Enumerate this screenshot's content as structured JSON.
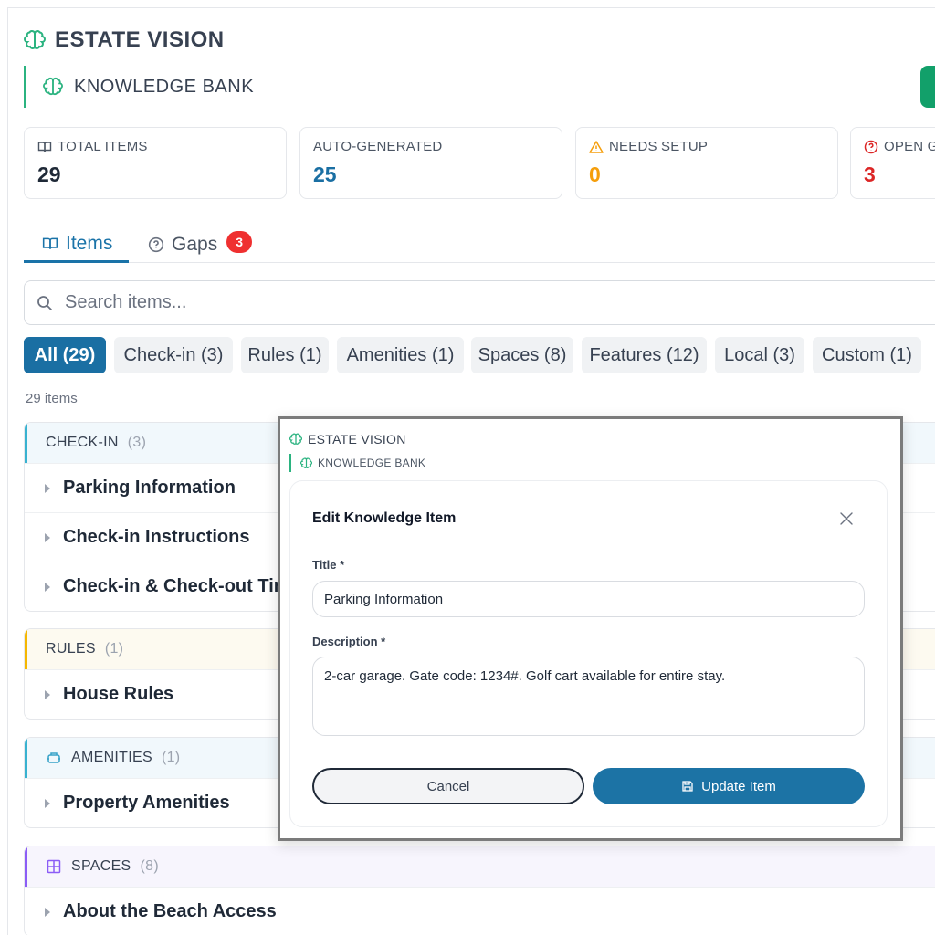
{
  "app": {
    "title": "ESTATE VISION"
  },
  "page": {
    "title": "KNOWLEDGE BANK"
  },
  "stats": [
    {
      "label": "TOTAL ITEMS",
      "value": "29",
      "icon": "book-icon",
      "color": "#1f2937"
    },
    {
      "label": "AUTO-GENERATED",
      "value": "25",
      "icon": "",
      "color": "#1a6fa3"
    },
    {
      "label": "NEEDS SETUP",
      "value": "0",
      "icon": "warning-icon",
      "color": "#f59e0b"
    },
    {
      "label": "OPEN G",
      "value": "3",
      "icon": "question-circle-icon",
      "color": "#dc2626"
    }
  ],
  "tabs": [
    {
      "label": "Items",
      "icon": "book-icon",
      "active": true
    },
    {
      "label": "Gaps",
      "icon": "question-circle-icon",
      "badge": "3"
    }
  ],
  "search": {
    "placeholder": "Search items..."
  },
  "filters": [
    {
      "label": "All (29)",
      "active": true
    },
    {
      "label": "Check-in (3)"
    },
    {
      "label": "Rules (1)"
    },
    {
      "label": "Amenities (1)"
    },
    {
      "label": "Spaces (8)"
    },
    {
      "label": "Features (12)"
    },
    {
      "label": "Local (3)"
    },
    {
      "label": "Custom (1)"
    }
  ],
  "count_text": "29 items",
  "groups": [
    {
      "name": "CHECK-IN",
      "count": "(3)",
      "accent": "#38b2d0",
      "icon": "",
      "items": [
        "Parking Information",
        "Check-in Instructions",
        "Check-in & Check-out Time"
      ]
    },
    {
      "name": "RULES",
      "count": "(1)",
      "accent": "#f5b700",
      "icon": "",
      "items": [
        "House Rules"
      ]
    },
    {
      "name": "AMENITIES",
      "count": "(1)",
      "accent": "#38b2d0",
      "icon": "amenities-icon",
      "items": [
        "Property Amenities"
      ]
    },
    {
      "name": "SPACES",
      "count": "(8)",
      "accent": "#8b5cf6",
      "icon": "grid-icon",
      "items": [
        "About the Beach Access"
      ]
    }
  ],
  "modal": {
    "app_title": "ESTATE VISION",
    "page_title": "KNOWLEDGE BANK",
    "heading": "Edit Knowledge Item",
    "title_label": "Title *",
    "title_value": "Parking Information",
    "description_label": "Description *",
    "description_value": "2-car garage. Gate code: 1234#. Golf cart available for entire stay.",
    "cancel_label": "Cancel",
    "update_label": "Update Item"
  },
  "colors": {
    "brand_green": "#2bb380",
    "primary": "#1a6fa3",
    "danger": "#ef3030"
  }
}
